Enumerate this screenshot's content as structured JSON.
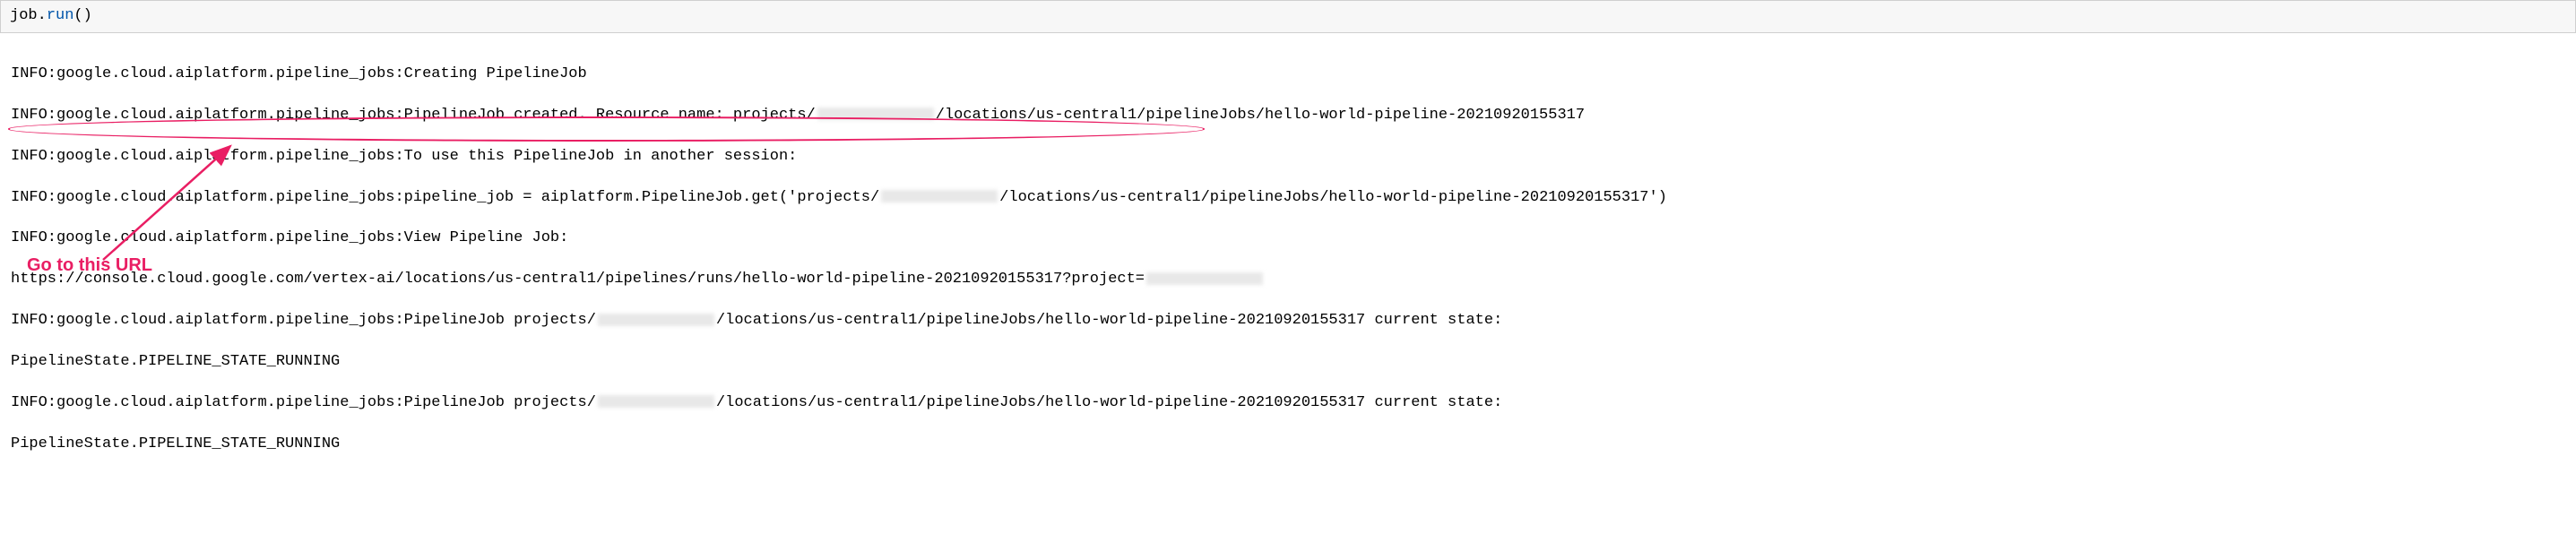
{
  "code": {
    "object": "job",
    "method": "run",
    "parens": "()"
  },
  "output": {
    "prefix": "INFO:google.cloud.aiplatform.pipeline_jobs:",
    "line1_suffix": "Creating PipelineJob",
    "line2_mid": "PipelineJob created. Resource name: projects/",
    "line2_end": "/locations/us-central1/pipelineJobs/hello-world-pipeline-20210920155317",
    "line3_suffix": "To use this PipelineJob in another session:",
    "line4_mid": "pipeline_job = aiplatform.PipelineJob.get('projects/",
    "line4_end": "/locations/us-central1/pipelineJobs/hello-world-pipeline-20210920155317')",
    "line5_suffix": "View Pipeline Job:",
    "url_prefix": "https://console.cloud.google.com/vertex-ai/locations/us-central1/pipelines/runs/hello-world-pipeline-20210920155317?project=",
    "line7_mid": "PipelineJob projects/",
    "line7_end": "/locations/us-central1/pipelineJobs/hello-world-pipeline-20210920155317 current state:",
    "state": "PipelineState.PIPELINE_STATE_RUNNING"
  },
  "annotation": {
    "text": "Go to this URL"
  }
}
